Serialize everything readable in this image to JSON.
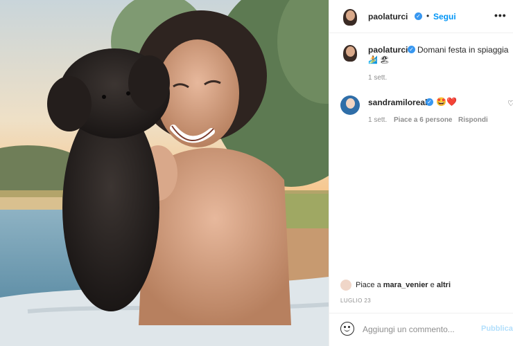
{
  "post": {
    "author": "paolaturci",
    "separator": "•",
    "follow_label": "Segui",
    "more_label": "•••",
    "photo_alt": "paolaturci photo"
  },
  "caption": {
    "author": "paolaturci",
    "text": "Domani festa in spiaggia",
    "emojis": "🏄 🏖",
    "time": "1 sett."
  },
  "comments": [
    {
      "author": "sandramiloreal",
      "emojis": "🤩❤️",
      "time": "1 sett.",
      "likes": "Piace a 6 persone",
      "reply": "Rispondi"
    }
  ],
  "likes_bar": {
    "prefix": "Piace a",
    "user": "mara_venier",
    "conj": "e",
    "others": "altri"
  },
  "date": "LUGLIO 23",
  "composer": {
    "placeholder": "Aggiungi un commento...",
    "publish": "Pubblica"
  },
  "colors": {
    "accent": "#0095f6",
    "verified": "#3897f0",
    "publish_disabled": "#b2dffc",
    "heart": "#e0245e"
  }
}
